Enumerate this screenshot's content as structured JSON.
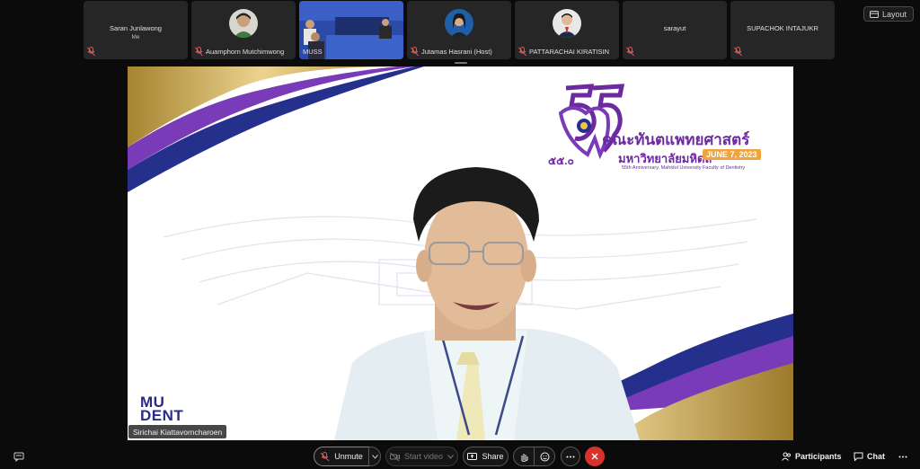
{
  "thumbnails": [
    {
      "name": "Saran Junlawong",
      "sub": "Me",
      "type": "text"
    },
    {
      "name": "Auamphorn Mutchimwong",
      "type": "avatar"
    },
    {
      "name": "MUSS",
      "type": "video"
    },
    {
      "name": "Jutamas Hasrani (Host)",
      "type": "avatar"
    },
    {
      "name": "PATTARACHAI KIRATISIN",
      "type": "avatar"
    },
    {
      "name": "sarayut",
      "type": "text"
    },
    {
      "name": "SUPACHOK INTAJUKR",
      "type": "text"
    }
  ],
  "layout_label": "Layout",
  "slide": {
    "thai_title": "คณะทันตแพทยศาสตร์",
    "thai_university": "มหาวิทยาลัยมหิดล",
    "date": "JUNE 7, 2023",
    "anniversary": "55th Anniversary, Mahidol University Faculty of Dentistry",
    "thai_number": "๕๕.๐",
    "logo_text_line1": "MU",
    "logo_text_line2": "DENT"
  },
  "speaker_name": "Sirichai Kiattavorncharoen",
  "controls": {
    "unmute": "Unmute",
    "start_video": "Start video",
    "share": "Share",
    "participants": "Participants",
    "chat": "Chat"
  },
  "colors": {
    "purple": "#6c2aa0",
    "navy": "#26308a",
    "gold": "#c8a24a",
    "end_call": "#d9322d"
  }
}
